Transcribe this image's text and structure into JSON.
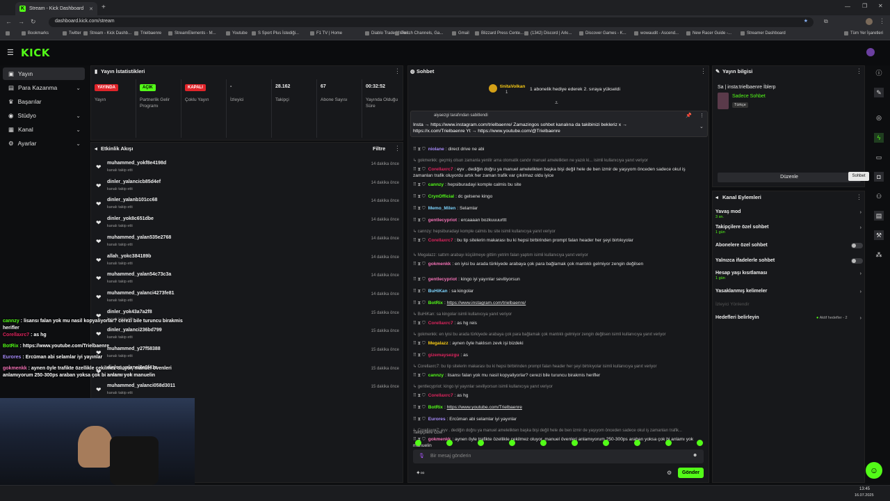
{
  "browser": {
    "tab_title": "Stream - Kick Dashboard",
    "url": "dashboard.kick.com/stream",
    "bookmarks": [
      "Bookmarks",
      "Twitter",
      "Stream - Kick Dashb...",
      "Trielbaenre",
      "StreamElements - M...",
      "Youtube",
      "S Sport Plus İstediği...",
      "F1 TV | Home",
      "Diablo Trade | Item...",
      "Twitch Channels, Ga...",
      "Gmail",
      "Blizzard Press Cente...",
      "(1342) Discord | Arkı...",
      "Discover Games - K...",
      "wowaudit - Ascend...",
      "New Racer Guide -...",
      "Streamer Dashboard"
    ],
    "all_bookmarks": "Tüm Yer İşaretleri"
  },
  "brand": {
    "logo": "KICK"
  },
  "nav": [
    {
      "label": "Yayın"
    },
    {
      "label": "Para Kazanma"
    },
    {
      "label": "Başarılar"
    },
    {
      "label": "Stüdyo"
    },
    {
      "label": "Kanal"
    },
    {
      "label": "Ayarlar"
    }
  ],
  "stats": {
    "title": "Yayın İstatistikleri",
    "items": [
      {
        "badge": "YAYINDA",
        "label": "Yayın",
        "color": "#e0242a"
      },
      {
        "badge": "AÇIK",
        "label": "Partnerlik Gelir Programı",
        "color": "#53fc18"
      },
      {
        "badge": "KAPALI",
        "label": "Çoklu Yayın",
        "color": "#e0242a"
      },
      {
        "value": "-",
        "label": "İzleyici"
      },
      {
        "value": "28.162",
        "label": "Takipçi"
      },
      {
        "value": "67",
        "label": "Abone Sayısı"
      },
      {
        "value": "00:32:52",
        "label": "Yayında Olduğu Süre"
      }
    ]
  },
  "activity": {
    "title": "Etkinlik Akışı",
    "filter": "Filtre",
    "items": [
      {
        "name": "muhammed_yokf8e4198d",
        "sub": "kanalı takip etti",
        "time": "14 dakika önce"
      },
      {
        "name": "dinler_yalancicb85d4ef",
        "sub": "kanalı takip etti",
        "time": "14 dakika önce"
      },
      {
        "name": "dinler_yalanb101cc68",
        "sub": "kanalı takip etti",
        "time": "14 dakika önce"
      },
      {
        "name": "dinler_yok8c651dbe",
        "sub": "kanalı takip etti",
        "time": "14 dakika önce"
      },
      {
        "name": "muhammed_yalan535e2768",
        "sub": "kanalı takip etti",
        "time": "14 dakika önce"
      },
      {
        "name": "allah_yokc384189b",
        "sub": "kanalı takip etti",
        "time": "14 dakika önce"
      },
      {
        "name": "muhammed_yalan54c73c3a",
        "sub": "kanalı takip etti",
        "time": "14 dakika önce"
      },
      {
        "name": "muhammed_yalanci4273fe81",
        "sub": "kanalı takip etti",
        "time": "14 dakika önce"
      },
      {
        "name": "dinler_yok43a7a2f8",
        "sub": "kanalı takip etti",
        "time": "15 dakika önce"
      },
      {
        "name": "dinler_yalanci236bd799",
        "sub": "kanalı takip etti",
        "time": "15 dakika önce"
      },
      {
        "name": "muhammed_y27f58388",
        "sub": "kanalı takip etti",
        "time": "15 dakika önce"
      },
      {
        "name": "dinler_yalanci8e9f41e",
        "sub": "kanalı takip etti",
        "time": "15 dakika önce"
      },
      {
        "name": "muhammed_yalanci058d3011",
        "sub": "kanalı takip etti",
        "time": "15 dakika önce"
      }
    ]
  },
  "chat": {
    "title": "Sohbet",
    "gift_user": "tinitaVolkan",
    "gift_count": "1",
    "gift_text": "1 abonelik hediye ederek 2. sıraya yükseldi",
    "pinned_by": "aiyaezgi tarafından sabitlendi",
    "pinned_msg": "Insta → https://www.instagram.com/trielbaenre/ Zamazingos sohbet kanalına da takibinizi bekleriz x → https://x.com/Trielbaenre Yt → https://www.youtube.com/@Trielbaenre",
    "messages": [
      {
        "user": "niolane",
        "color": "#a78bfa",
        "text": "direct drive ne abi"
      },
      {
        "reply": "gokmenkk: geçmiş olsun zamanla yenilir ama otomatik candır manuel amelelikten ne yazık ki... isimli kullanıcıya yanıt veriyor"
      },
      {
        "user": "Corellaxrc7",
        "color": "#e0245e",
        "text": "eyv . dediğin doğru ya manuel amelelikten başka bişi değil hele de ben izmir de yaşıyom önceden sadece okul iş zamanları trafik oluyordu artık her zaman trafik var çıkılmaz oldu iyice"
      },
      {
        "user": "cannzy",
        "color": "#53fc18",
        "text": "hepsiburadayi komple calmis bu site"
      },
      {
        "user": "CrynOfficial",
        "color": "#53fc18",
        "text": "dc gelsene kingo"
      },
      {
        "user": "Memo_Milen",
        "color": "#7dd3fc",
        "text": "Selamlar"
      },
      {
        "user": "gentlecypriot",
        "color": "#f472b6",
        "text": "ercaaaan bozkuuuurttt"
      },
      {
        "reply": "cannzy: hepsiburadayi komple calmis bu site isimli kullanıcıya yanıt veriyor"
      },
      {
        "user": "Corellaxrc7",
        "color": "#e0245e",
        "text": "bu tip sitelerin makarası bu ki hepsi birbirinden prompt falan header her şeyi birtıkıyolar"
      },
      {
        "reply": "Megalazz: sattım arabayı küçülmeye gittim yetrim falan yaptım isimli kullanıcıya yanıt veriyor"
      },
      {
        "user": "gokmenkk",
        "color": "#f472b6",
        "text": "en iyisi bu arada türkiyede arabaya çok para bağlamak çok mantıklı gelmiyor zengin değilsen"
      },
      {
        "user": "gentlecypriot",
        "color": "#f472b6",
        "text": "kingo iyi yayınlar seviliyorsun"
      },
      {
        "user": "BuHiKan",
        "color": "#7dd3fc",
        "text": "sa kingolar"
      },
      {
        "user": "BotRix",
        "color": "#53fc18",
        "text": "https://www.instagram.com/trielbaenre/"
      },
      {
        "reply": "BuHiKan: sa kingolar isimli kullanıcıya yanıt veriyor"
      },
      {
        "user": "Corellaxrc7",
        "color": "#e0245e",
        "text": "as hg reis"
      },
      {
        "reply": "gokmenkk: en iyisi bu arada türkiyede arabaya çok para bağlamak çok mantıklı gelmiyor zengin değilsen isimli kullanıcıya yanıt veriyor"
      },
      {
        "user": "Megalazz",
        "color": "#facc15",
        "text": "aynen öyle haklısın zevk işi bizdeki"
      },
      {
        "user": "gizemaysezgu",
        "color": "#e0245e",
        "text": "as"
      },
      {
        "reply": "Corellaxrc7: bu tip sitelerin makarası bu ki hepsi birbirinden prompt falan header her şeyi birtıkıyolar isimli kullanıcıya yanıt veriyor"
      },
      {
        "user": "cannzy",
        "color": "#53fc18",
        "text": "lisansı falan yok mu nasil kopyaliyorlar? cerezi bile turuncu birakmis herifler"
      },
      {
        "reply": "gentlecypriot: kingo iyi yayınlar seviliyorsun isimli kullanıcıya yanıt veriyor"
      },
      {
        "user": "Corellaxrc7",
        "color": "#e0245e",
        "text": "as hg"
      },
      {
        "user": "BotRix",
        "color": "#53fc18",
        "text": "https://www.youtube.com/Trielbaenre"
      },
      {
        "user": "Eurores",
        "color": "#a78bfa",
        "text": "Ercüman abi selamlar iyi yayınlar"
      },
      {
        "reply": "Corellaxrc7: eyv . dediğin doğru ya manuel amelelikten başka bişi değil hele de ben izmir de yaşıyom önceden sadece okul iş zamanları trafik..."
      },
      {
        "user": "gokmenkk",
        "color": "#f472b6",
        "text": "aynen öyle trafikte özellikle çekilmez oluyor, manuel övenleri anlamıyorum 250-300ps araban yoksa çok bi anlamı yok manuelin"
      }
    ],
    "followers_only": "Takipçilere Özel",
    "input_placeholder": "Bir mesaj gönderin",
    "send": "Gönder"
  },
  "stream_info": {
    "title": "Yayın bilgisi",
    "stream_title": "Sa | insta:trielbaenre İblerp",
    "category": "Sadece Sohbet",
    "language": "Türkçe",
    "edit": "Düzenle",
    "tooltip": "Sohbet"
  },
  "channel_actions": {
    "title": "Kanal Eylemleri",
    "items": [
      {
        "label": "Yavaş mod",
        "sub": "3 sn."
      },
      {
        "label": "Takipçilere özel sohbet",
        "sub": "1 gün"
      },
      {
        "label": "Abonelere özel sohbet",
        "sub": ""
      },
      {
        "label": "Yalnızca ifadelerle sohbet",
        "sub": ""
      },
      {
        "label": "Hesap yaşı kısıtlaması",
        "sub": "1 gün"
      },
      {
        "label": "Yasaklanmış kelimeler",
        "sub": ""
      }
    ],
    "disabled": "İzleyici Yönlendir",
    "goals": "Hedefleri belirleyin",
    "goals_active": "Aktif hedefler - 2"
  },
  "overlay": [
    {
      "user": "cannzy",
      "color": "#53fc18",
      "text": "lisansı falan yok mu nasil kopyaliyorlar? cerezi bile turuncu birakmis herifler"
    },
    {
      "user": "Corellaxrc7",
      "color": "#e0245e",
      "text": "as hg"
    },
    {
      "user": "BotRix",
      "color": "#53fc18",
      "text": "https://www.youtube.com/Trielbaenre"
    },
    {
      "user": "Eurores",
      "color": "#a78bfa",
      "text": "Ercüman abi selamlar iyi yayınlar"
    },
    {
      "user": "gokmenkk",
      "color": "#f472b6",
      "text": "aynen öyle trafikte özellikle çekilmez oluyor, manuel övenleri anlamıyorum 250-300ps araban yoksa çok bi anlamı yok manuelin"
    }
  ],
  "taskbar": {
    "time": "13:45",
    "date": "16.07.2025"
  }
}
